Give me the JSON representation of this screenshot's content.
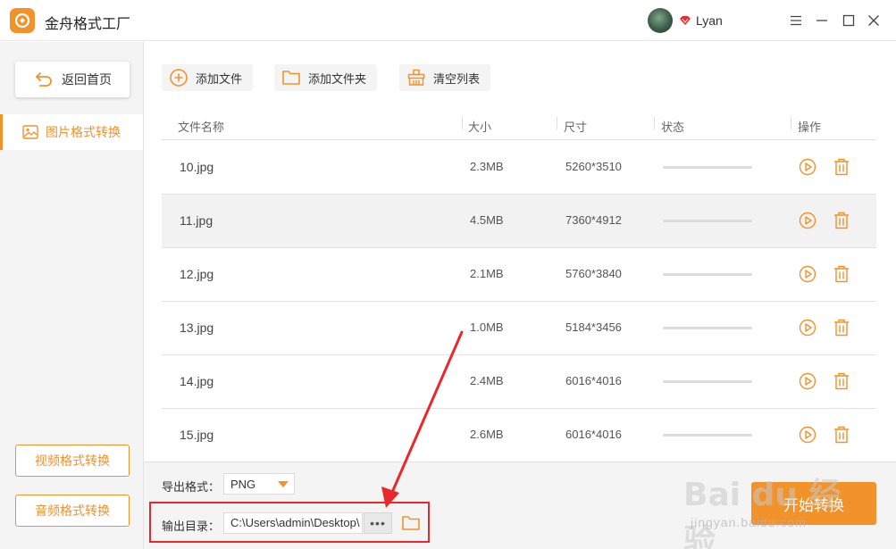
{
  "app": {
    "title": "金舟格式工厂"
  },
  "user": {
    "name": "Lyan"
  },
  "sidebar": {
    "back_label": "返回首页",
    "active_item": "图片格式转换",
    "video_label": "视频格式转换",
    "audio_label": "音频格式转换"
  },
  "toolbar": {
    "add_file": "添加文件",
    "add_folder": "添加文件夹",
    "clear_list": "清空列表"
  },
  "table": {
    "headers": {
      "name": "文件名称",
      "size": "大小",
      "dimension": "尺寸",
      "status": "状态",
      "action": "操作"
    },
    "rows": [
      {
        "name": "10.jpg",
        "size": "2.3MB",
        "dimension": "5260*3510",
        "progress": 0
      },
      {
        "name": "11.jpg",
        "size": "4.5MB",
        "dimension": "7360*4912",
        "progress": 0
      },
      {
        "name": "12.jpg",
        "size": "2.1MB",
        "dimension": "5760*3840",
        "progress": 0
      },
      {
        "name": "13.jpg",
        "size": "1.0MB",
        "dimension": "5184*3456",
        "progress": 0
      },
      {
        "name": "14.jpg",
        "size": "2.4MB",
        "dimension": "6016*4016",
        "progress": 0
      },
      {
        "name": "15.jpg",
        "size": "2.6MB",
        "dimension": "6016*4016",
        "progress": 0
      }
    ]
  },
  "bottom": {
    "format_label": "导出格式：",
    "format_value": "PNG",
    "dir_label": "输出目录：",
    "dir_value": "C:\\Users\\admin\\Desktop\\",
    "dots": "•••",
    "start_label": "开始转换"
  },
  "watermark": {
    "text": "Bai du 经验",
    "sub": "jingyan.baidu.com"
  },
  "colors": {
    "accent": "#f2922b",
    "annotation": "#e8282b"
  }
}
